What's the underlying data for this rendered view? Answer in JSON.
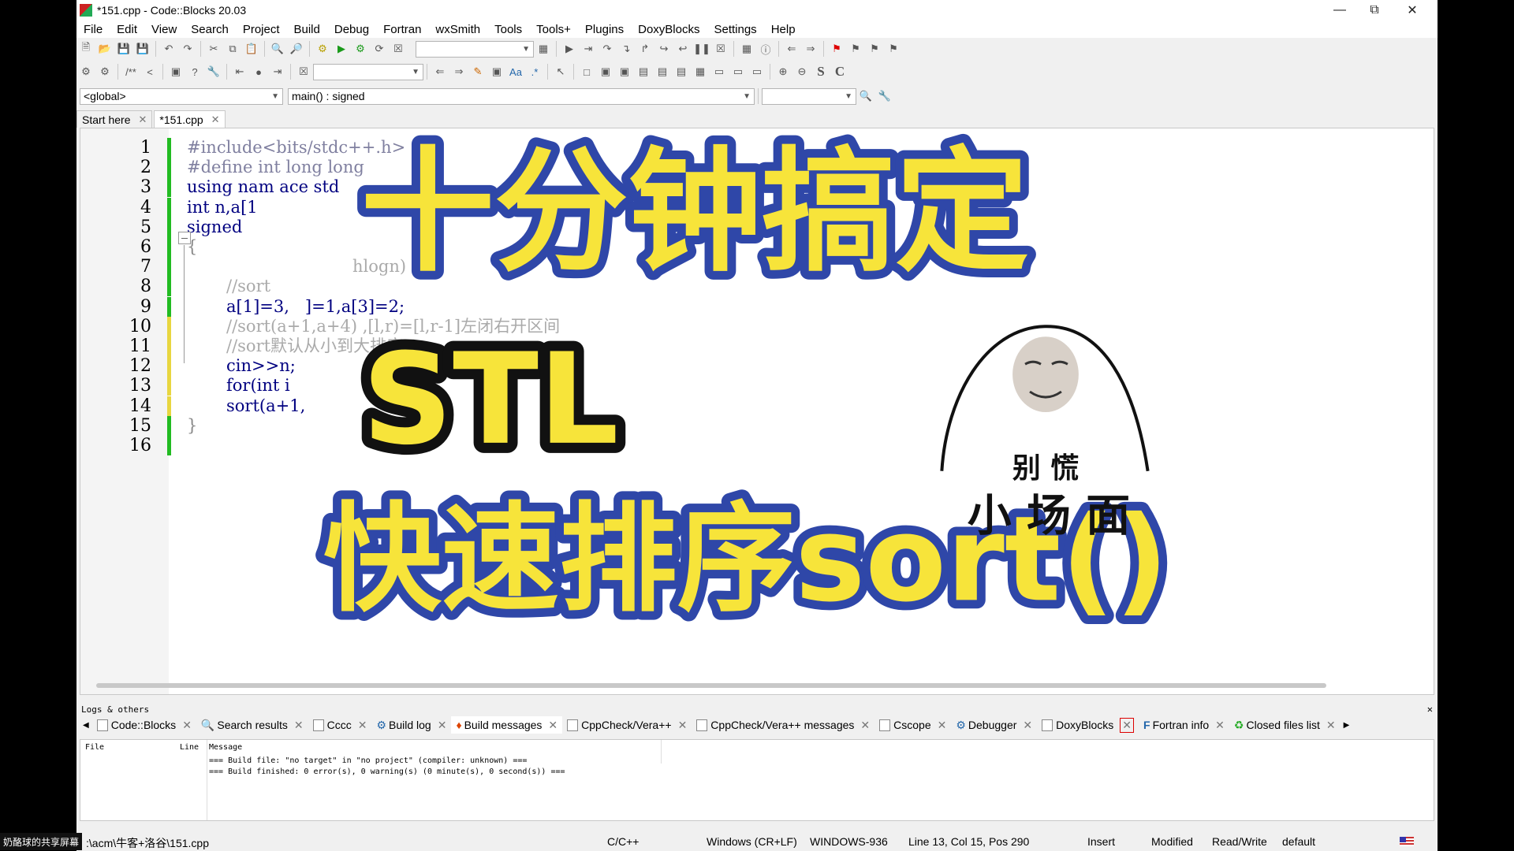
{
  "window": {
    "title": "*151.cpp - Code::Blocks 20.03"
  },
  "menu": [
    "File",
    "Edit",
    "View",
    "Search",
    "Project",
    "Build",
    "Debug",
    "Fortran",
    "wxSmith",
    "Tools",
    "Tools+",
    "Plugins",
    "DoxyBlocks",
    "Settings",
    "Help"
  ],
  "scope": {
    "global": "<global>",
    "function": "main() : signed"
  },
  "tabs": [
    {
      "label": "Start here"
    },
    {
      "label": "*151.cpp"
    }
  ],
  "code_lines": [
    {
      "n": "1",
      "text": "#include<bits/stdc++.h>"
    },
    {
      "n": "2",
      "text": "#define int long long"
    },
    {
      "n": "3",
      "text": "using nam ace std"
    },
    {
      "n": "4",
      "text": "int n,a[1"
    },
    {
      "n": "5",
      "text": "signed"
    },
    {
      "n": "6",
      "text": "{"
    },
    {
      "n": "7",
      "text": "hlogn)"
    },
    {
      "n": "8",
      "text": "//sort"
    },
    {
      "n": "9",
      "text": "a[1]=3,   ]=1,a[3]=2;"
    },
    {
      "n": "10",
      "text": "//sort(a+1,a+4) ,[l,r)=[l,r-1]左闭右开区间"
    },
    {
      "n": "11",
      "text": "//sort默认从小到大排序"
    },
    {
      "n": "12",
      "text": "cin>>n;"
    },
    {
      "n": "13",
      "text": "for(int i"
    },
    {
      "n": "14",
      "text": "sort(a+1,"
    },
    {
      "n": "15",
      "text": "}"
    },
    {
      "n": "16",
      "text": ""
    }
  ],
  "overlay": {
    "headline": "十分钟搞定",
    "stl": "STL",
    "bottom": "快速排序sort()",
    "meme_line1": "别 慌",
    "meme_line2": "小 场 面"
  },
  "logs": {
    "header": "Logs & others",
    "tabs": [
      "Code::Blocks",
      "Search results",
      "Cccc",
      "Build log",
      "Build messages",
      "CppCheck/Vera++",
      "CppCheck/Vera++ messages",
      "Cscope",
      "Debugger",
      "DoxyBlocks",
      "Fortran info",
      "Closed files list"
    ],
    "columns": {
      "file": "File",
      "line": "Line",
      "message": "Message"
    },
    "messages": [
      "=== Build file: \"no target\" in \"no project\" (compiler: unknown) ===",
      "=== Build finished: 0 error(s), 0 warning(s) (0 minute(s), 0 second(s)) ==="
    ]
  },
  "status": {
    "path": ":\\acm\\牛客+洛谷\\151.cpp",
    "watermark": "奶酪球的共享屏幕",
    "lang": "C/C++",
    "eol": "Windows (CR+LF)",
    "encoding": "WINDOWS-936",
    "position": "Line 13, Col 15, Pos 290",
    "mode": "Insert",
    "modified": "Modified",
    "rw": "Read/Write",
    "profile": "default"
  },
  "colors": {
    "accent_yellow": "#f7e43a",
    "outline_blue": "#2f47a8",
    "change_green": "#22bb22",
    "change_yellow": "#e8d640"
  }
}
